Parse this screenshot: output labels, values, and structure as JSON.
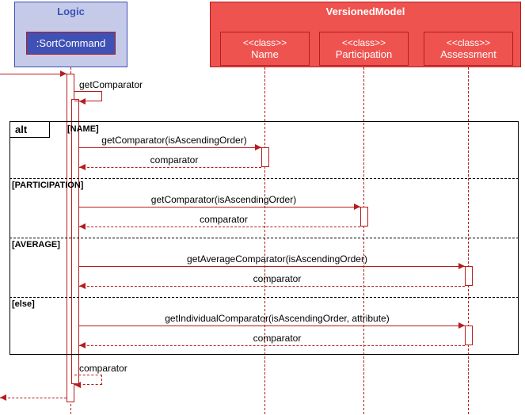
{
  "containers": {
    "logic": "Logic",
    "versioned": "VersionedModel"
  },
  "participants": {
    "sort": ":SortCommand",
    "name_stereo": "<<class>>",
    "name": "Name",
    "part_stereo": "<<class>>",
    "part": "Participation",
    "assess_stereo": "<<class>>",
    "assess": "Assessment"
  },
  "alt_label": "alt",
  "guards": {
    "name": "[NAME]",
    "participation": "[PARTICIPATION]",
    "average": "[AVERAGE]",
    "else": "[else]"
  },
  "messages": {
    "entry": "",
    "self_get": "getComparator",
    "to_name": "getComparator(isAscendingOrder)",
    "ret_name": "comparator",
    "to_part": "getComparator(isAscendingOrder)",
    "ret_part": "comparator",
    "to_avg": "getAverageComparator(isAscendingOrder)",
    "ret_avg": "comparator",
    "to_else": "getIndividualComparator(isAscendingOrder, attribute)",
    "ret_else": "comparator",
    "self_ret": "comparator",
    "exit": ""
  },
  "chart_data": {
    "type": "sequence_diagram",
    "containers": [
      {
        "name": "Logic",
        "participants": [
          ":SortCommand"
        ]
      },
      {
        "name": "VersionedModel",
        "participants": [
          "<<class>> Name",
          "<<class>> Participation",
          "<<class>> Assessment"
        ]
      }
    ],
    "interactions": [
      {
        "from": "external",
        "to": ":SortCommand",
        "message": ""
      },
      {
        "from": ":SortCommand",
        "to": ":SortCommand",
        "message": "getComparator",
        "self": true
      },
      {
        "fragment": "alt",
        "operands": [
          {
            "guard": "[NAME]",
            "messages": [
              {
                "from": ":SortCommand",
                "to": "Name",
                "message": "getComparator(isAscendingOrder)"
              },
              {
                "from": "Name",
                "to": ":SortCommand",
                "message": "comparator",
                "return": true
              }
            ]
          },
          {
            "guard": "[PARTICIPATION]",
            "messages": [
              {
                "from": ":SortCommand",
                "to": "Participation",
                "message": "getComparator(isAscendingOrder)"
              },
              {
                "from": "Participation",
                "to": ":SortCommand",
                "message": "comparator",
                "return": true
              }
            ]
          },
          {
            "guard": "[AVERAGE]",
            "messages": [
              {
                "from": ":SortCommand",
                "to": "Assessment",
                "message": "getAverageComparator(isAscendingOrder)"
              },
              {
                "from": "Assessment",
                "to": ":SortCommand",
                "message": "comparator",
                "return": true
              }
            ]
          },
          {
            "guard": "[else]",
            "messages": [
              {
                "from": ":SortCommand",
                "to": "Assessment",
                "message": "getIndividualComparator(isAscendingOrder, attribute)"
              },
              {
                "from": "Assessment",
                "to": ":SortCommand",
                "message": "comparator",
                "return": true
              }
            ]
          }
        ]
      },
      {
        "from": ":SortCommand",
        "to": ":SortCommand",
        "message": "comparator",
        "return": true,
        "self": true
      },
      {
        "from": ":SortCommand",
        "to": "external",
        "message": "",
        "return": true
      }
    ]
  }
}
